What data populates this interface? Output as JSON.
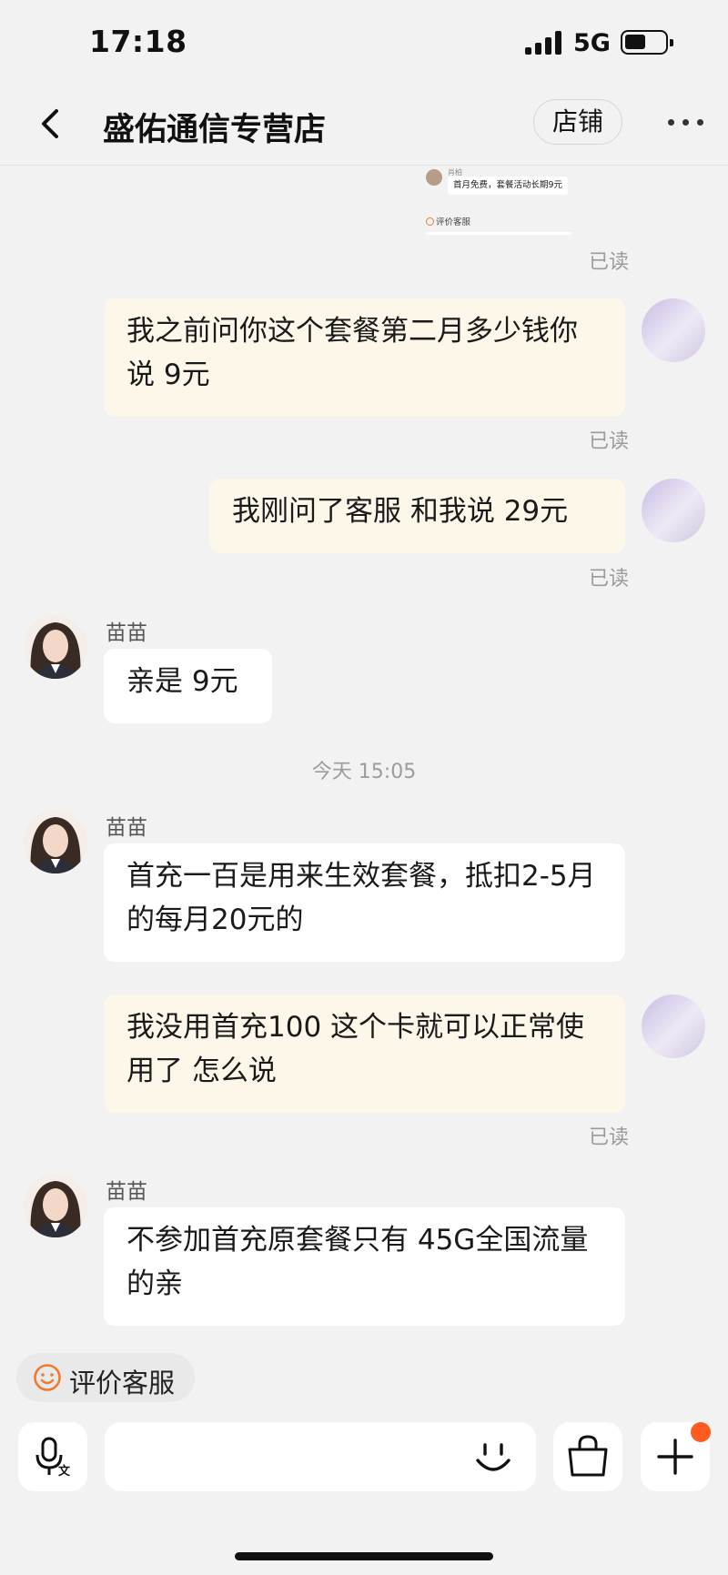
{
  "status_bar": {
    "time": "17:18",
    "network": "5G"
  },
  "header": {
    "title": "盛佑通信专营店",
    "store_button": "店铺"
  },
  "quoted_image": {
    "sender": "肖柏",
    "message": "首月免费，套餐活动长期9元",
    "rate_label": "评价客服"
  },
  "read_label": "已读",
  "agent_name": "苗苗",
  "messages": [
    {
      "from": "me",
      "text": "我之前问你这个套餐第二月多少钱你说 9元",
      "read": "已读"
    },
    {
      "from": "me",
      "text": "我刚问了客服 和我说 29元",
      "read": "已读"
    },
    {
      "from": "agent",
      "sender": "苗苗",
      "text": "亲是 9元"
    },
    {
      "from": "agent",
      "sender": "苗苗",
      "text": "首充一百是用来生效套餐，抵扣2-5月的每月20元的"
    },
    {
      "from": "me",
      "text": "我没用首充100 这个卡就可以正常使用了 怎么说",
      "read": "已读"
    },
    {
      "from": "agent",
      "sender": "苗苗",
      "text": "不参加首充原套餐只有 45G全国流量的亲"
    }
  ],
  "timestamp": "今天 15:05",
  "rate_service": "评价客服",
  "colors": {
    "my_bubble": "#fdf7ea",
    "agent_bubble": "#ffffff",
    "badge": "#ff5a1f",
    "rate_icon": "#f07a2c"
  },
  "icons": [
    "back-icon",
    "more-icon",
    "voice-to-text-icon",
    "emoji-icon",
    "shopping-bag-icon",
    "plus-icon",
    "smile-rate-icon"
  ]
}
